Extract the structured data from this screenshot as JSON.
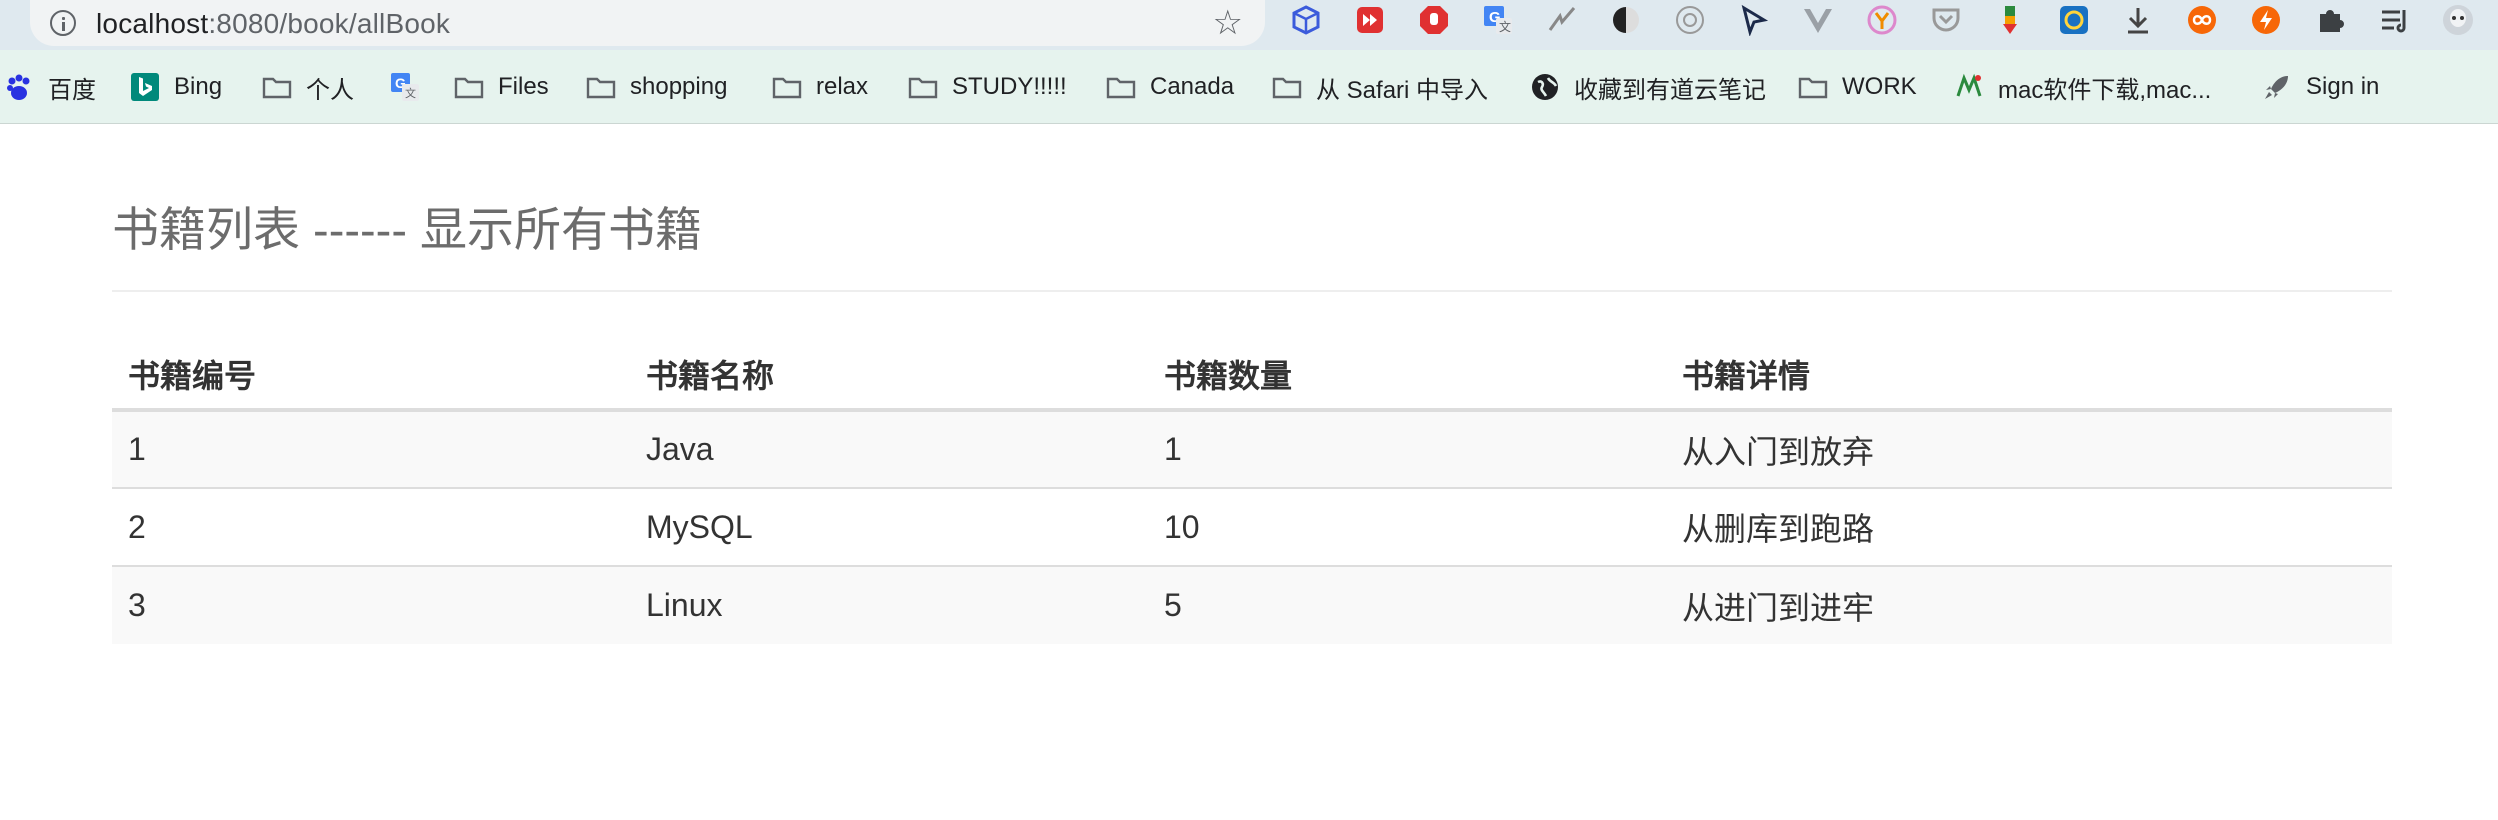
{
  "browser": {
    "url_host": "localhost",
    "url_rest": ":8080/book/allBook",
    "extensions": [
      "cube-icon",
      "record-icon",
      "stop-hand-icon",
      "google-translate-icon",
      "slash-icon",
      "half-moon-icon",
      "camera-icon",
      "cursor-icon",
      "vue-icon",
      "y-combinator-icon",
      "pocket-icon",
      "thermometer-icon",
      "globe-target-icon",
      "download-icon",
      "infinity-icon",
      "lightning-icon",
      "puzzle-icon",
      "reading-list-icon",
      "profile-avatar-icon"
    ],
    "bookmarks": [
      {
        "label": "百度",
        "icon": "baidu-paw-icon"
      },
      {
        "label": "Bing",
        "icon": "bing-icon"
      },
      {
        "label": "个人",
        "icon": "folder-icon"
      },
      {
        "label": "",
        "icon": "google-translate-icon"
      },
      {
        "label": "Files",
        "icon": "folder-icon"
      },
      {
        "label": "shopping",
        "icon": "folder-icon"
      },
      {
        "label": "relax",
        "icon": "folder-icon"
      },
      {
        "label": "STUDY!!!!!",
        "icon": "folder-icon"
      },
      {
        "label": "Canada",
        "icon": "folder-icon"
      },
      {
        "label": "从 Safari 中导入",
        "icon": "folder-icon"
      },
      {
        "label": "收藏到有道云笔记",
        "icon": "globe-icon"
      },
      {
        "label": "WORK",
        "icon": "folder-icon"
      },
      {
        "label": "mac软件下载,mac...",
        "icon": "mac-download-site-icon"
      },
      {
        "label": "Sign in",
        "icon": "rocket-icon"
      }
    ]
  },
  "page": {
    "title": "书籍列表 ------ 显示所有书籍"
  },
  "table": {
    "headers": [
      "书籍编号",
      "书籍名称",
      "书籍数量",
      "书籍详情"
    ],
    "rows": [
      [
        "1",
        "Java",
        "1",
        "从入门到放弃"
      ],
      [
        "2",
        "MySQL",
        "10",
        "从删库到跑路"
      ],
      [
        "3",
        "Linux",
        "5",
        "从进门到进牢"
      ]
    ]
  }
}
